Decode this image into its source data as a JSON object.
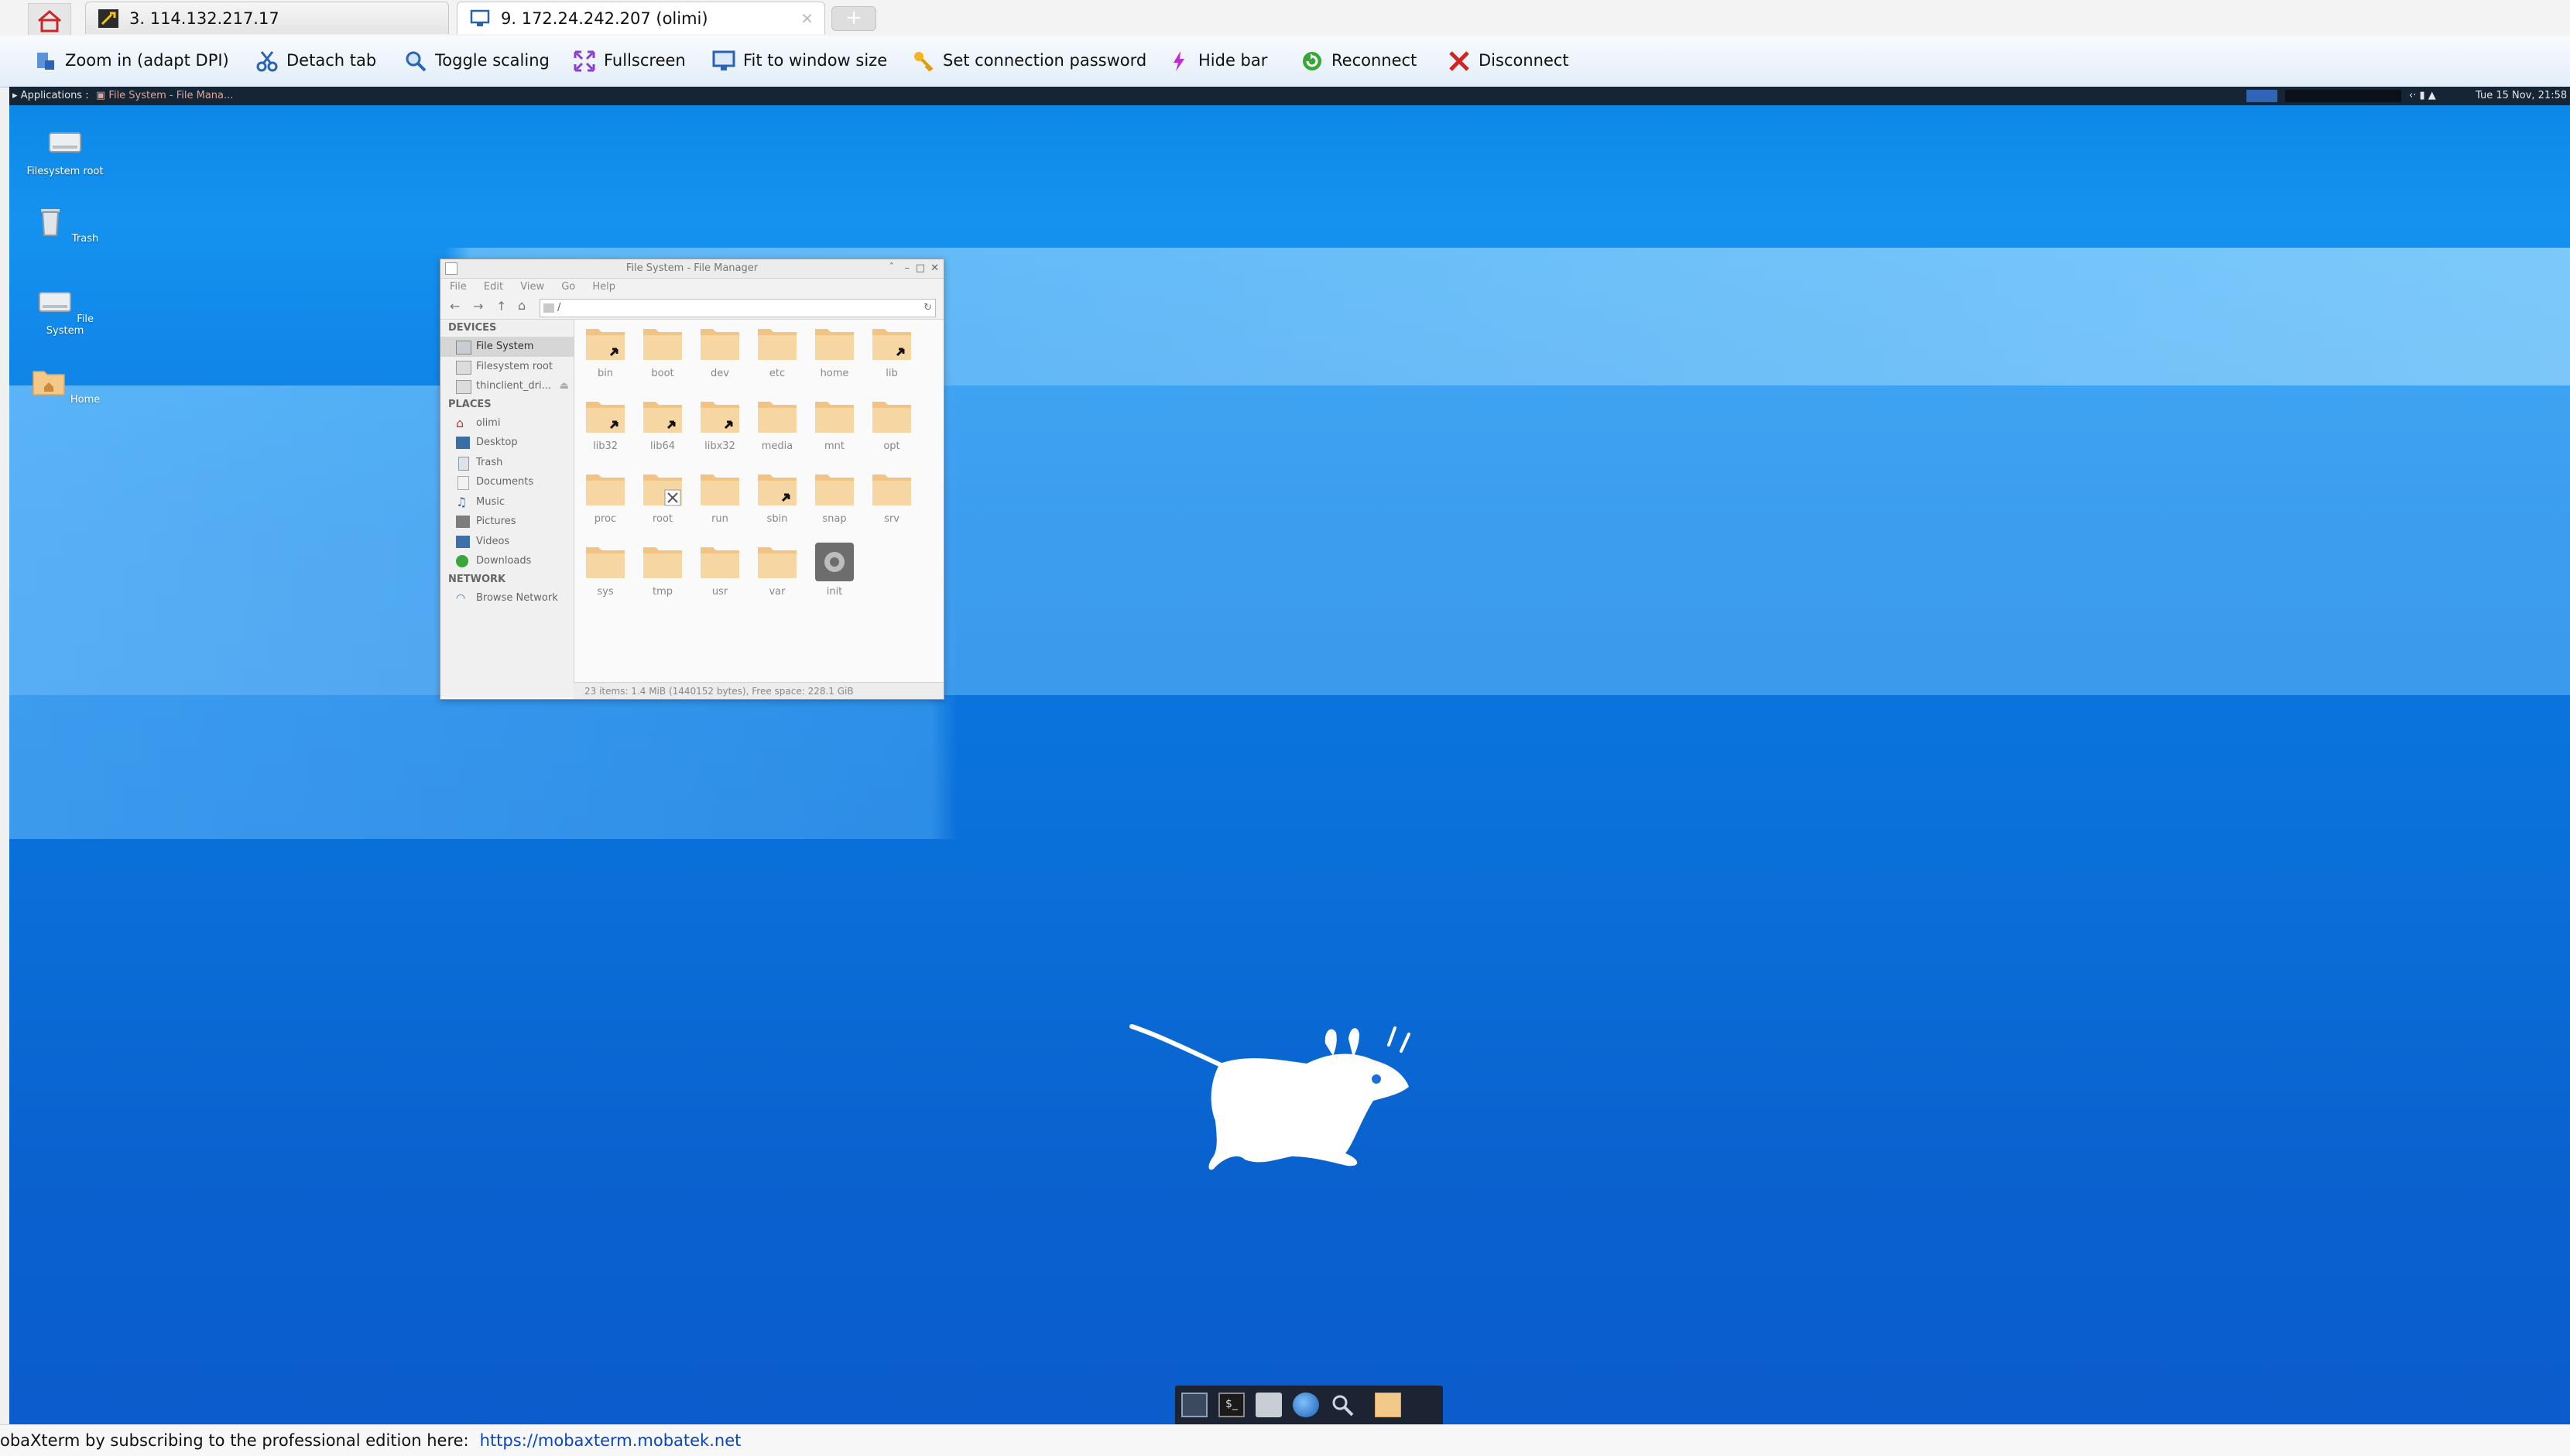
{
  "tabs": [
    {
      "label": "3. 114.132.217.17",
      "icon": "wrench-key-icon"
    },
    {
      "label": "9. 172.24.242.207 (olimi)",
      "icon": "monitor-icon"
    }
  ],
  "toolbar": {
    "zoom_in": "Zoom in (adapt DPI)",
    "detach_tab": "Detach tab",
    "toggle_scaling": "Toggle scaling",
    "fullscreen": "Fullscreen",
    "fit_window": "Fit to window size",
    "set_password": "Set connection password",
    "hide_bar": "Hide bar",
    "reconnect": "Reconnect",
    "disconnect": "Disconnect"
  },
  "xfce_panel": {
    "applications": "Applications :",
    "task": "File System - File Mana...",
    "clock": "Tue 15 Nov, 21:58"
  },
  "desktop_icons": [
    {
      "label": "Filesystem root"
    },
    {
      "label": "Trash"
    },
    {
      "label": "File System"
    },
    {
      "label": "Home"
    }
  ],
  "file_manager": {
    "title": "File System - File Manager",
    "menu": [
      "File",
      "Edit",
      "View",
      "Go",
      "Help"
    ],
    "path": "/",
    "devices_header": "DEVICES",
    "devices": [
      "File System",
      "Filesystem root",
      "thinclient_dri..."
    ],
    "places_header": "PLACES",
    "places": [
      "olimi",
      "Desktop",
      "Trash",
      "Documents",
      "Music",
      "Pictures",
      "Videos",
      "Downloads"
    ],
    "network_header": "NETWORK",
    "network": [
      "Browse Network"
    ],
    "folders": [
      {
        "name": "bin",
        "link": true
      },
      {
        "name": "boot",
        "link": false
      },
      {
        "name": "dev",
        "link": false
      },
      {
        "name": "etc",
        "link": false
      },
      {
        "name": "home",
        "link": false
      },
      {
        "name": "lib",
        "link": true
      },
      {
        "name": "lib32",
        "link": true
      },
      {
        "name": "lib64",
        "link": true
      },
      {
        "name": "libx32",
        "link": true
      },
      {
        "name": "media",
        "link": false
      },
      {
        "name": "mnt",
        "link": false
      },
      {
        "name": "opt",
        "link": false
      },
      {
        "name": "proc",
        "link": false
      },
      {
        "name": "root",
        "link": false,
        "locked": true
      },
      {
        "name": "run",
        "link": false
      },
      {
        "name": "sbin",
        "link": true
      },
      {
        "name": "snap",
        "link": false
      },
      {
        "name": "srv",
        "link": false
      },
      {
        "name": "sys",
        "link": false
      },
      {
        "name": "tmp",
        "link": false
      },
      {
        "name": "usr",
        "link": false
      },
      {
        "name": "var",
        "link": false
      },
      {
        "name": "init",
        "type": "executable"
      }
    ],
    "status": "23 items: 1.4 MiB (1440152 bytes), Free space: 228.1 GiB"
  },
  "footer": {
    "text": "obaXterm by subscribing to the professional edition here:",
    "link": "https://mobaxterm.mobatek.net"
  }
}
